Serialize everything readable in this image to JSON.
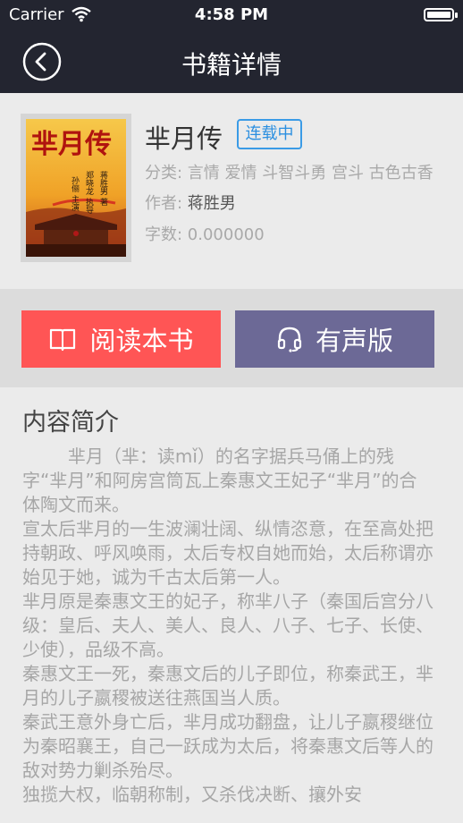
{
  "status_bar": {
    "carrier": "Carrier",
    "time": "4:58 PM",
    "icons": [
      "wifi-icon",
      "battery-icon"
    ]
  },
  "nav": {
    "title": "书籍详情",
    "back_icon": "chevron-left-circle-icon"
  },
  "book": {
    "title": "芈月传",
    "status": "连载中",
    "category_label": "分类: ",
    "categories": "言情 爱情 斗智斗勇 宫斗 古色古香",
    "author_label": "作者: ",
    "author": "蒋胜男",
    "words_label": "字数: ",
    "words": "0.000000",
    "cover": {
      "title": "芈月传",
      "author_line": "蒋胜男 著",
      "cast_line_1": "郑晓龙 执导",
      "cast_line_2": "孙俪 主演"
    }
  },
  "actions": {
    "read_label": "阅读本书",
    "read_icon": "book-icon",
    "audio_label": "有声版",
    "audio_icon": "headphones-icon"
  },
  "intro": {
    "heading": "内容简介",
    "body": "        芈月（芈：读mǐ）的名字据兵马俑上的残字“芈月”和阿房宫筒瓦上秦惠文王妃子“芈月”的合体陶文而来。\n宣太后芈月的一生波澜壮阔、纵情恣意，在至高处把持朝政、呼风唤雨，太后专权自她而始，太后称谓亦始见于她，诚为千古太后第一人。\n芈月原是秦惠文王的妃子，称芈八子（秦国后宫分八级：皇后、夫人、美人、良人、八子、七子、长使、少使），品级不高。\n秦惠文王一死，秦惠文后的儿子即位，称秦武王，芈月的儿子嬴稷被送往燕国当人质。\n秦武王意外身亡后，芈月成功翻盘，让儿子嬴稷继位为秦昭襄王，自己一跃成为太后，将秦惠文后等人的敌对势力剿杀殆尽。\n独揽大权，临朝称制，又杀伐决断、攘外安"
  },
  "colors": {
    "nav_bg": "#232530",
    "read_button": "#ff5555",
    "audio_button": "#6c6996",
    "badge": "#3a9be6"
  }
}
